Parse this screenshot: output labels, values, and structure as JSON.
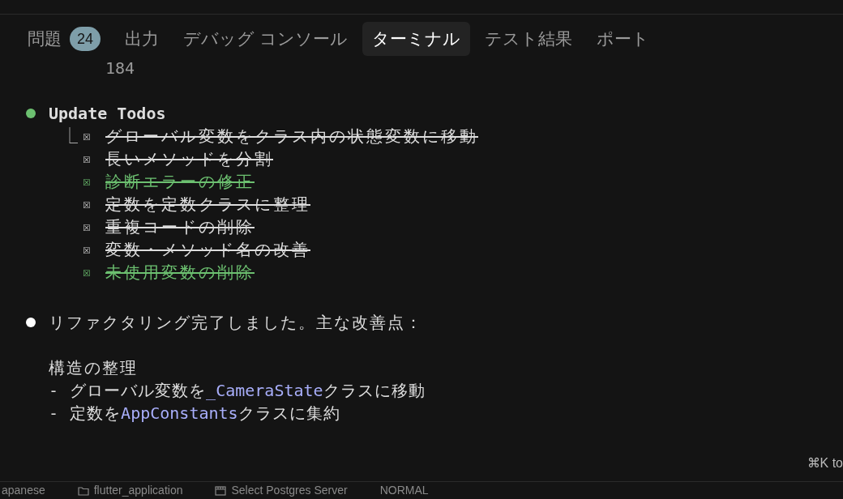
{
  "tabs": [
    {
      "label": "問題",
      "selected": false,
      "badge": "24"
    },
    {
      "label": "出力",
      "selected": false
    },
    {
      "label": "デバッグ コンソール",
      "selected": false
    },
    {
      "label": "ターミナル",
      "selected": true
    },
    {
      "label": "テスト結果",
      "selected": false
    },
    {
      "label": "ポート",
      "selected": false
    }
  ],
  "terminal": {
    "line_number": "184",
    "todo": {
      "color": "#6cc070",
      "title": "Update Todos",
      "tree_glyph": "⎿",
      "items": [
        {
          "checkbox": "☒",
          "text": "グローバル変数をクラス内の状態変数に移動",
          "done": true,
          "highlighted": false
        },
        {
          "checkbox": "☒",
          "text": "長いメソッドを分割",
          "done": true,
          "highlighted": false
        },
        {
          "checkbox": "☒",
          "text": "診断エラーの修正",
          "done": true,
          "highlighted": true
        },
        {
          "checkbox": "☒",
          "text": "定数を定数クラスに整理",
          "done": true,
          "highlighted": false
        },
        {
          "checkbox": "☒",
          "text": "重複コードの削除",
          "done": true,
          "highlighted": false
        },
        {
          "checkbox": "☒",
          "text": "変数・メソッド名の改善",
          "done": true,
          "highlighted": false
        },
        {
          "checkbox": "☒",
          "text": "未使用変数の削除",
          "done": true,
          "highlighted": true
        }
      ]
    },
    "message": {
      "color": "#ffffff",
      "title": "リファクタリング完了しました。主な改善点：",
      "heading": "構造の整理",
      "lines": [
        [
          {
            "kind": "text",
            "text": "- グローバル変数を"
          },
          {
            "kind": "code",
            "text": "_CameraState"
          },
          {
            "kind": "text",
            "text": "クラスに移動"
          }
        ],
        [
          {
            "kind": "text",
            "text": "- 定数を"
          },
          {
            "kind": "code",
            "text": "AppConstants"
          },
          {
            "kind": "text",
            "text": "クラスに集約"
          }
        ]
      ]
    }
  },
  "hint": "⌘K to",
  "status_bar": [
    {
      "kind": "plain",
      "text": "apanese"
    },
    {
      "kind": "folder",
      "text": "flutter_application"
    },
    {
      "kind": "server",
      "text": "Select Postgres Server"
    },
    {
      "kind": "plain",
      "text": "NORMAL"
    }
  ]
}
